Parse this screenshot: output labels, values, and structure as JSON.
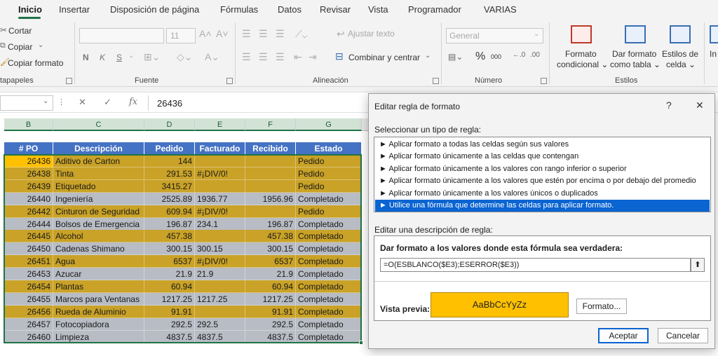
{
  "ribbon": {
    "tabs": [
      "Inicio",
      "Insertar",
      "Disposición de página",
      "Fórmulas",
      "Datos",
      "Revisar",
      "Vista",
      "Programador",
      "VARIAS"
    ],
    "clipboard": {
      "cut": "Cortar",
      "copy": "Copiar",
      "copy_format": "Copiar formato",
      "group_label": "tapapeles"
    },
    "font": {
      "font_size": "11",
      "bold": "N",
      "italic": "K",
      "underline": "S",
      "group_label": "Fuente"
    },
    "alignment": {
      "wrap_text": "Ajustar texto",
      "merge_center": "Combinar y centrar",
      "group_label": "Alineación"
    },
    "number": {
      "format_value": "General",
      "percent": "%",
      "thousands": "000",
      "group_label": "Número"
    },
    "styles": {
      "conditional_format": [
        "Formato",
        "condicional ⌄"
      ],
      "format_as_table": [
        "Dar formato",
        "como tabla ⌄"
      ],
      "cell_styles": [
        "Estilos de",
        "celda ⌄"
      ],
      "insert_partial": "In",
      "group_label": "Estilos"
    }
  },
  "formula_bar": {
    "fx_label": "fx",
    "cancel_icon": "✕",
    "enter_icon": "✓",
    "value": "26436"
  },
  "sheet": {
    "column_letters": [
      "B",
      "C",
      "D",
      "E",
      "F",
      "G"
    ],
    "headers": [
      "# PO",
      "Descripción",
      "Pedido",
      "Facturado",
      "Recibido",
      "Estado"
    ],
    "rows": [
      {
        "po": "26436",
        "desc": "Aditivo de Carton",
        "pedido": "144",
        "facturado": "",
        "recibido": "",
        "estado": "Pedido",
        "hl": true
      },
      {
        "po": "26438",
        "desc": "Tinta",
        "pedido": "291.53",
        "facturado": "#¡DIV/0!",
        "recibido": "",
        "estado": "Pedido",
        "hl": true
      },
      {
        "po": "26439",
        "desc": "Etiquetado",
        "pedido": "3415.27",
        "facturado": "",
        "recibido": "",
        "estado": "Pedido",
        "hl": true
      },
      {
        "po": "26440",
        "desc": "Ingeniería",
        "pedido": "2525.89",
        "facturado": "1936.77",
        "recibido": "1956.96",
        "estado": "Completado",
        "hl": false
      },
      {
        "po": "26442",
        "desc": "Cinturon de Seguridad",
        "pedido": "609.94",
        "facturado": "#¡DIV/0!",
        "recibido": "",
        "estado": "Pedido",
        "hl": true
      },
      {
        "po": "26444",
        "desc": "Bolsos de Emergencia",
        "pedido": "196.87",
        "facturado": "234.1",
        "recibido": "196.87",
        "estado": "Completado",
        "hl": false
      },
      {
        "po": "26445",
        "desc": "Alcohol",
        "pedido": "457.38",
        "facturado": "",
        "recibido": "457.38",
        "estado": "Completado",
        "hl": true
      },
      {
        "po": "26450",
        "desc": "Cadenas Shimano",
        "pedido": "300.15",
        "facturado": "300.15",
        "recibido": "300.15",
        "estado": "Completado",
        "hl": false
      },
      {
        "po": "26451",
        "desc": "Agua",
        "pedido": "6537",
        "facturado": "#¡DIV/0!",
        "recibido": "6537",
        "estado": "Completado",
        "hl": true
      },
      {
        "po": "26453",
        "desc": "Azucar",
        "pedido": "21.9",
        "facturado": "21.9",
        "recibido": "21.9",
        "estado": "Completado",
        "hl": false
      },
      {
        "po": "26454",
        "desc": "Plantas",
        "pedido": "60.94",
        "facturado": "",
        "recibido": "60.94",
        "estado": "Completado",
        "hl": true
      },
      {
        "po": "26455",
        "desc": "Marcos para Ventanas",
        "pedido": "1217.25",
        "facturado": "1217.25",
        "recibido": "1217.25",
        "estado": "Completado",
        "hl": false
      },
      {
        "po": "26456",
        "desc": "Rueda de Aluminio",
        "pedido": "91.91",
        "facturado": "",
        "recibido": "91.91",
        "estado": "Completado",
        "hl": true
      },
      {
        "po": "26457",
        "desc": "Fotocopiadora",
        "pedido": "292.5",
        "facturado": "292.5",
        "recibido": "292.5",
        "estado": "Completado",
        "hl": false
      },
      {
        "po": "26460",
        "desc": "Limpieza",
        "pedido": "4837.5",
        "facturado": "4837.5",
        "recibido": "4837.5",
        "estado": "Completado",
        "hl": false
      }
    ]
  },
  "dialog": {
    "title": "Editar regla de formato",
    "help": "?",
    "close": "✕",
    "rule_type_label": "Seleccionar un tipo de regla:",
    "rule_types": [
      "► Aplicar formato a todas las celdas según sus valores",
      "► Aplicar formato únicamente a las celdas que contengan",
      "► Aplicar formato únicamente a los valores con rango inferior o superior",
      "► Aplicar formato únicamente a los valores que estén por encima o por debajo del promedio",
      "► Aplicar formato únicamente a los valores únicos o duplicados",
      "► Utilice una fórmula que determine las celdas para aplicar formato."
    ],
    "selected_rule_index": 5,
    "edit_desc_label": "Editar una descripción de regla:",
    "formula_label": "Dar formato a los valores donde esta fórmula sea verdadera:",
    "formula_value": "=O(ESBLANCO($E3);ESERROR($E3))",
    "collapse_icon": "⬆",
    "preview_label": "Vista previa:",
    "preview_text": "AaBbCcYyZz",
    "format_button": "Formato...",
    "ok_button": "Aceptar",
    "cancel_button": "Cancelar"
  },
  "colors": {
    "highlight": "#ffc000",
    "highlight_dim": "#c9a227",
    "gray_row": "#b8bcc4",
    "header_blue": "#4472c4",
    "excel_green": "#217346",
    "selection_blue": "#0a64d2"
  }
}
